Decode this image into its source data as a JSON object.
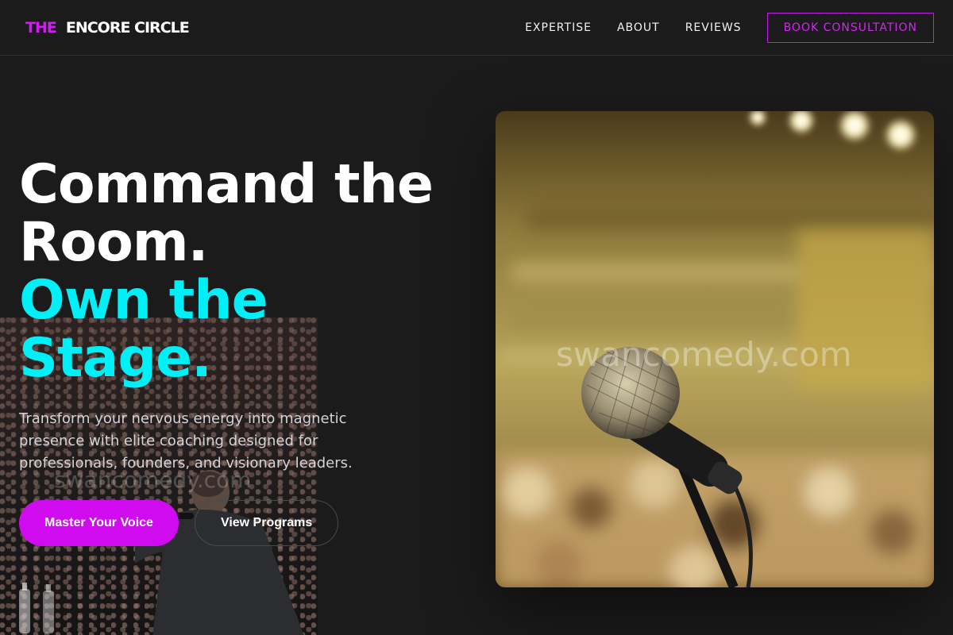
{
  "brand": {
    "prefix": "THE",
    "name": "ENCORE CIRCLE"
  },
  "nav": {
    "links": [
      "EXPERTISE",
      "ABOUT",
      "REVIEWS"
    ],
    "cta": "BOOK CONSULTATION"
  },
  "hero": {
    "headline_line1": "Command the",
    "headline_line2": "Room.",
    "headline_line3": "Own the",
    "headline_line4": "Stage.",
    "subtext": "Transform your nervous energy into magnetic presence with elite coaching designed for professionals, founders, and visionary leaders.",
    "primary_button": "Master Your Voice",
    "secondary_button": "View Programs"
  },
  "watermarks": {
    "photo_left": "swancomedy.com",
    "photo_right": "swancomedy.com"
  },
  "colors": {
    "background": "#1b1b1c",
    "accent_magenta": "#d10bf0",
    "accent_cyan": "#00f0f8"
  },
  "icons": {
    "speaker_photo": "speaker-photo",
    "microphone_photo": "microphone-photo"
  }
}
